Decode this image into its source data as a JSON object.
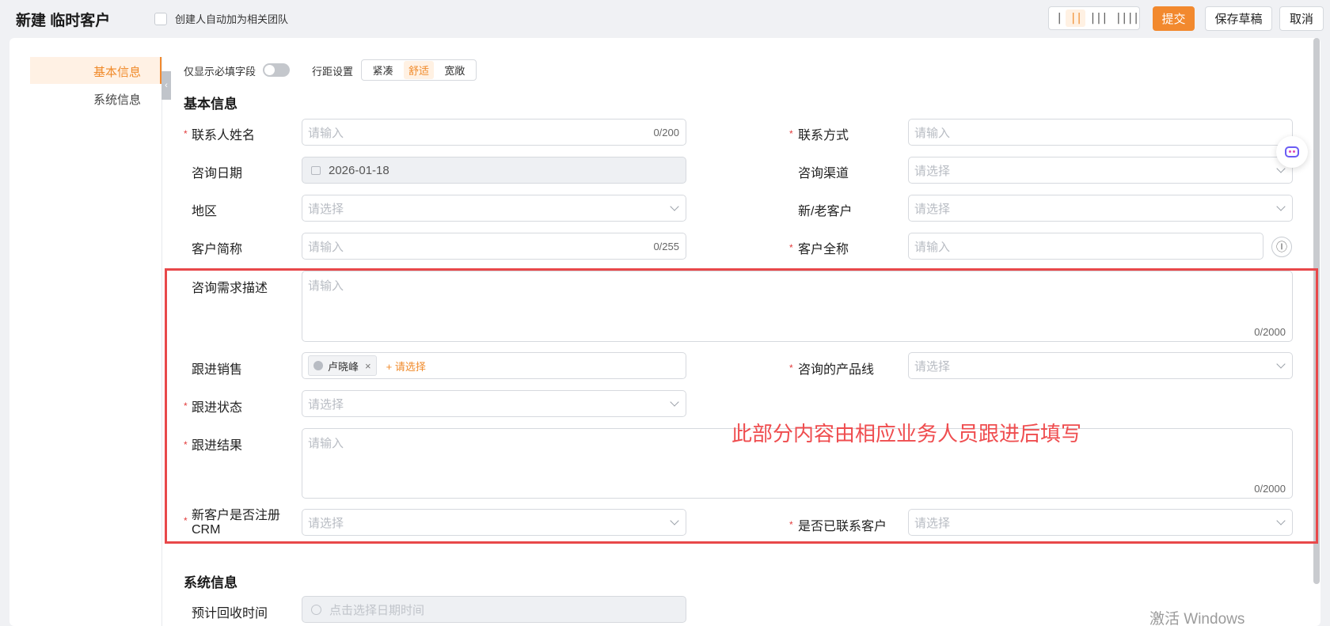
{
  "header": {
    "title": "新建 临时客户",
    "auto_team_label": "创建人自动加为相关团队",
    "density_options": [
      "|",
      "||",
      "|||",
      "||||"
    ],
    "submit": "提交",
    "save_draft": "保存草稿",
    "cancel": "取消"
  },
  "nav": {
    "items": [
      "基本信息",
      "系统信息"
    ],
    "collapse_icon": "‹"
  },
  "toolbar": {
    "required_only_label": "仅显示必填字段",
    "spacing_label": "行距设置",
    "spacing_options": [
      "紧凑",
      "舒适",
      "宽敞"
    ]
  },
  "sections": {
    "basic": "基本信息",
    "system": "系统信息"
  },
  "fields": {
    "contact_name": {
      "label": "联系人姓名",
      "placeholder": "请输入",
      "counter": "0/200"
    },
    "contact_method": {
      "label": "联系方式",
      "placeholder": "请输入"
    },
    "consult_date": {
      "label": "咨询日期",
      "value": "2026-01-18"
    },
    "consult_channel": {
      "label": "咨询渠道",
      "placeholder": "请选择"
    },
    "region": {
      "label": "地区",
      "placeholder": "请选择"
    },
    "new_old": {
      "label": "新/老客户",
      "placeholder": "请选择"
    },
    "short_name": {
      "label": "客户简称",
      "placeholder": "请输入",
      "counter": "0/255"
    },
    "full_name": {
      "label": "客户全称",
      "placeholder": "请输入",
      "icon": "Ⓘ"
    },
    "description": {
      "label": "咨询需求描述",
      "placeholder": "请输入",
      "counter": "0/2000"
    },
    "sales": {
      "label": "跟进销售",
      "tag": "卢晓峰",
      "tag_close": "×",
      "add": "+ 请选择"
    },
    "product_line": {
      "label": "咨询的产品线",
      "placeholder": "请选择"
    },
    "status": {
      "label": "跟进状态",
      "placeholder": "请选择"
    },
    "result": {
      "label": "跟进结果",
      "placeholder": "请输入",
      "counter": "0/2000"
    },
    "crm_label_line1": "新客户是否注册",
    "crm_label_line2": "CRM",
    "crm_placeholder": "请选择",
    "contacted": {
      "label": "是否已联系客户",
      "placeholder": "请选择"
    },
    "return_time": {
      "label": "预计回收时间",
      "placeholder": "点击选择日期时间"
    }
  },
  "annotation": "此部分内容由相应业务人员跟进后填写",
  "watermark": "激活 Windows",
  "required_mark": "*",
  "colors": {
    "accent": "#f2892e",
    "highlight": "#e8484a"
  }
}
